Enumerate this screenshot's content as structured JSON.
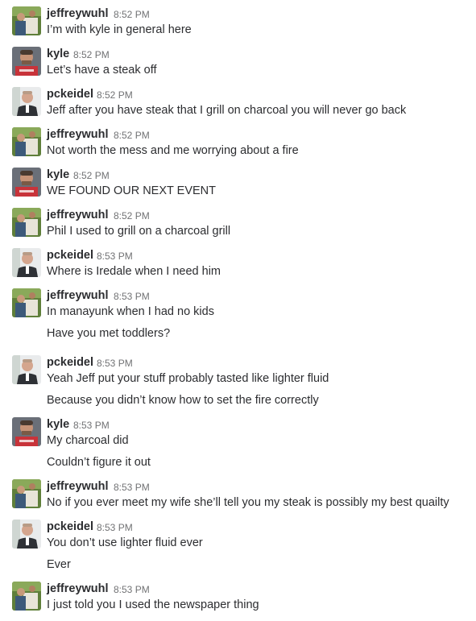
{
  "colors": {
    "background": "#ffffff",
    "text": "#2c2d30",
    "timestamp": "#717274"
  },
  "avatars": {
    "jeffreywuhl": "jeffreywuhl-avatar-icon",
    "kyle": "kyle-avatar-icon",
    "pckeidel": "pckeidel-avatar-icon"
  },
  "messages": [
    {
      "author": "jeffreywuhl",
      "time": "8:52 PM",
      "lines": [
        "I’m with kyle in general here"
      ]
    },
    {
      "author": "kyle",
      "time": "8:52 PM",
      "lines": [
        "Let’s have a steak off"
      ]
    },
    {
      "author": "pckeidel",
      "time": "8:52 PM",
      "lines": [
        "Jeff after you have steak that I grill on charcoal you will never go back"
      ]
    },
    {
      "author": "jeffreywuhl",
      "time": "8:52 PM",
      "lines": [
        "Not worth the mess and me worrying about a fire"
      ]
    },
    {
      "author": "kyle",
      "time": "8:52 PM",
      "lines": [
        "WE FOUND OUR NEXT EVENT"
      ]
    },
    {
      "author": "jeffreywuhl",
      "time": "8:52 PM",
      "lines": [
        "Phil I used to grill on a charcoal grill"
      ]
    },
    {
      "author": "pckeidel",
      "time": "8:53 PM",
      "lines": [
        "Where is Iredale when I need him"
      ]
    },
    {
      "author": "jeffreywuhl",
      "time": "8:53 PM",
      "lines": [
        "In manayunk when I had no kids",
        "Have you met toddlers?"
      ]
    },
    {
      "author": "pckeidel",
      "time": "8:53 PM",
      "lines": [
        "Yeah Jeff put your stuff probably tasted like lighter fluid",
        "Because you didn’t know how to set the fire correctly"
      ]
    },
    {
      "author": "kyle",
      "time": "8:53 PM",
      "lines": [
        "My charcoal did",
        "Couldn’t figure it out"
      ]
    },
    {
      "author": "jeffreywuhl",
      "time": "8:53 PM",
      "lines": [
        "No if you ever meet my wife she’ll tell you my steak is possibly my best quailty"
      ]
    },
    {
      "author": "pckeidel",
      "time": "8:53 PM",
      "lines": [
        "You don’t use lighter fluid ever",
        "Ever"
      ]
    },
    {
      "author": "jeffreywuhl",
      "time": "8:53 PM",
      "lines": [
        "I just told you I used the newspaper thing"
      ]
    }
  ]
}
